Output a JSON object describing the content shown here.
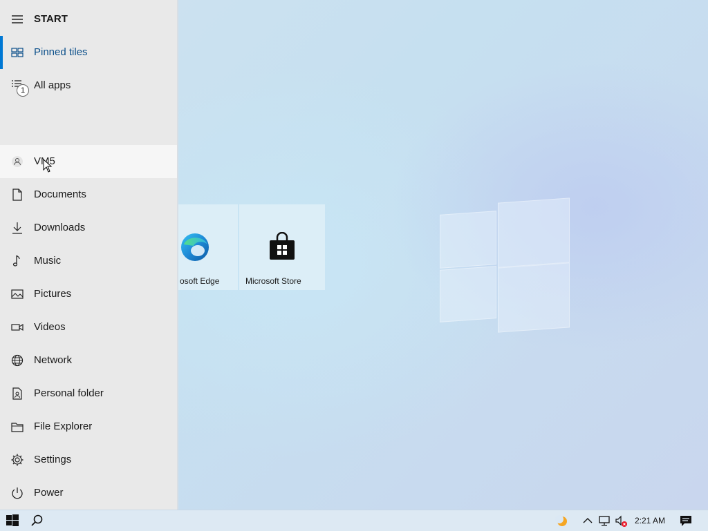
{
  "start_menu": {
    "header": {
      "label": "START",
      "icon": "hamburger-icon"
    },
    "items": [
      {
        "name": "pinned-tiles",
        "label": "Pinned tiles",
        "icon": "tiles-icon",
        "selected": true
      },
      {
        "name": "all-apps",
        "label": "All apps",
        "icon": "list-icon",
        "badge": "1"
      },
      {
        "name": "user",
        "label": "VM5",
        "icon": "person-icon"
      },
      {
        "name": "documents",
        "label": "Documents",
        "icon": "document-icon"
      },
      {
        "name": "downloads",
        "label": "Downloads",
        "icon": "download-icon"
      },
      {
        "name": "music",
        "label": "Music",
        "icon": "music-note-icon"
      },
      {
        "name": "pictures",
        "label": "Pictures",
        "icon": "picture-icon"
      },
      {
        "name": "videos",
        "label": "Videos",
        "icon": "video-icon"
      },
      {
        "name": "network",
        "label": "Network",
        "icon": "globe-icon"
      },
      {
        "name": "personal-folder",
        "label": "Personal folder",
        "icon": "personal-folder-icon"
      },
      {
        "name": "file-explorer",
        "label": "File Explorer",
        "icon": "folder-icon"
      },
      {
        "name": "settings",
        "label": "Settings",
        "icon": "gear-icon"
      },
      {
        "name": "power",
        "label": "Power",
        "icon": "power-icon"
      }
    ]
  },
  "tiles": [
    {
      "name": "microsoft-edge-tile",
      "label": "osoft Edge",
      "icon": "edge-icon"
    },
    {
      "name": "microsoft-store-tile",
      "label": "Microsoft Store",
      "icon": "store-icon"
    }
  ],
  "taskbar": {
    "start_icon": "windows-icon",
    "search_icon": "search-icon",
    "tray": [
      "weather-icon",
      "chevron-up-icon",
      "network-icon",
      "volume-muted-icon"
    ],
    "time": "2:21 AM",
    "notification_icon": "action-center-icon"
  },
  "colors": {
    "accent": "#0078d4",
    "start_bg": "#e9e9e9",
    "taskbar_bg": "#dde9f3"
  }
}
